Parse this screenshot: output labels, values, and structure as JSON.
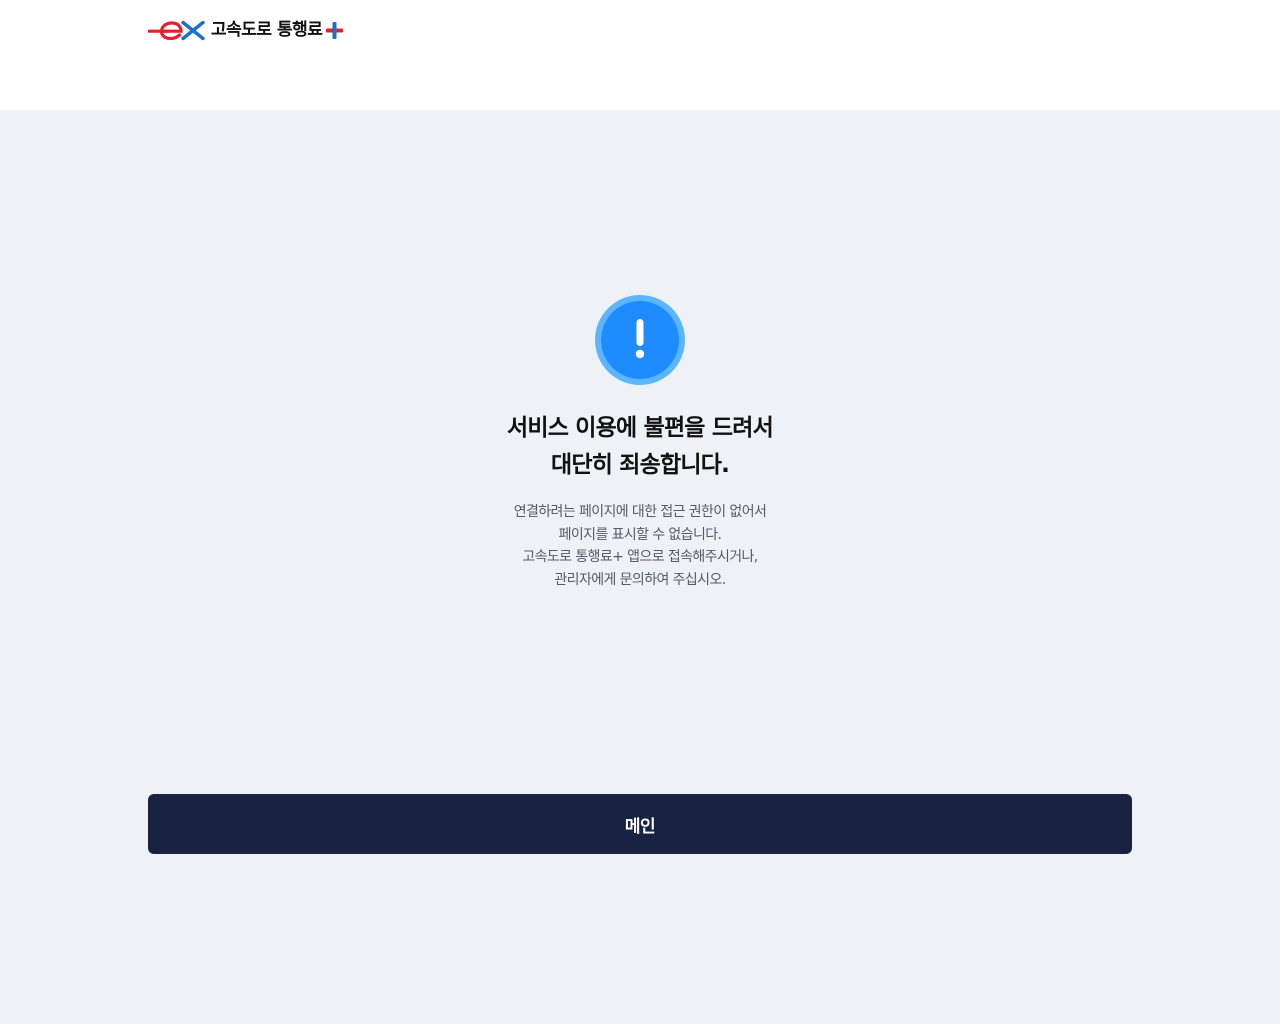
{
  "header": {
    "logo_text": "고속도로 통행료",
    "colors": {
      "brand_red": "#e3202b",
      "brand_blue": "#1a6fd1",
      "plus_red": "#e3202b",
      "plus_blue": "#1a6fd1"
    }
  },
  "error": {
    "icon": "exclamation-icon",
    "icon_color": "#1e8cff",
    "icon_ring_color": "#5bb5ff",
    "title_lines": [
      "서비스 이용에 불편을 드려서",
      "대단히 죄송합니다."
    ],
    "description_lines": [
      "연결하려는 페이지에 대한 접근 권한이 없어서",
      "페이지를 표시할 수 없습니다.",
      "고속도로 통행료+ 앱으로 접속해주시거나,",
      "관리자에게 문의하여 주십시오."
    ]
  },
  "actions": {
    "main_button_label": "메인",
    "button_color": "#182241"
  }
}
